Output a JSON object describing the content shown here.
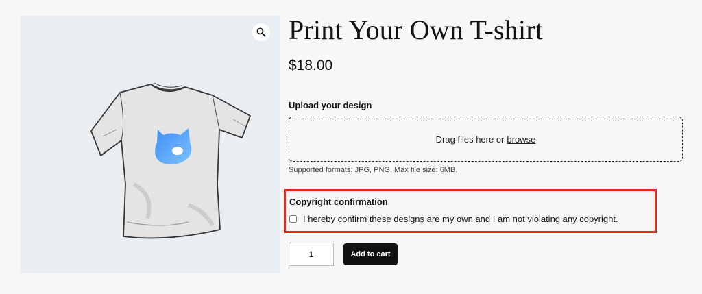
{
  "product": {
    "title": "Print Your Own T-shirt",
    "price": "$18.00",
    "image_icon": "t-shirt-with-blue-cat-logo"
  },
  "gallery": {
    "zoom_icon": "magnifier-icon"
  },
  "upload": {
    "label": "Upload your design",
    "dropzone_text": "Drag files here or",
    "browse_link": "browse",
    "hint": "Supported formats: JPG, PNG. Max file size: 6MB."
  },
  "copyright": {
    "title": "Copyright confirmation",
    "checkbox_label": "I hereby confirm these designs are my own and I am not violating any copyright.",
    "checked": false,
    "highlight_color": "#e8291c"
  },
  "cart": {
    "quantity": "1",
    "add_button": "Add to cart"
  },
  "colors": {
    "gallery_bg": "#e9eef3",
    "page_bg": "#f7f7f7",
    "button_bg": "#111111",
    "logo_gradient": [
      "#3f8df5",
      "#7cc2ff"
    ]
  }
}
